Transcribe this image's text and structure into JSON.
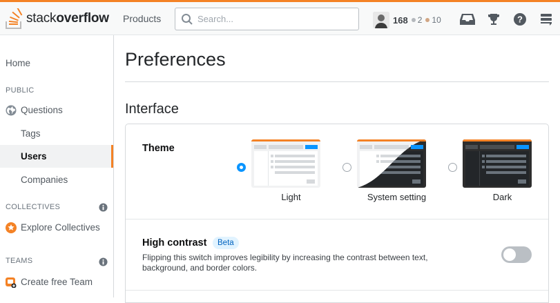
{
  "header": {
    "logo_text_light": "stack",
    "logo_text_bold": "overflow",
    "products_label": "Products",
    "search_placeholder": "Search...",
    "reputation": "168",
    "silver_badges": "2",
    "bronze_badges": "10",
    "accent_color": "#f48225"
  },
  "sidebar": {
    "home": "Home",
    "public_label": "PUBLIC",
    "questions": "Questions",
    "tags": "Tags",
    "users": "Users",
    "companies": "Companies",
    "collectives_label": "COLLECTIVES",
    "explore_collectives": "Explore Collectives",
    "teams_label": "TEAMS",
    "create_team": "Create free Team"
  },
  "main": {
    "title": "Preferences",
    "section": "Interface",
    "theme_label": "Theme",
    "theme_options": [
      {
        "label": "Light",
        "selected": true
      },
      {
        "label": "System setting",
        "selected": false
      },
      {
        "label": "Dark",
        "selected": false
      }
    ],
    "high_contrast_label": "High contrast",
    "beta_badge": "Beta",
    "high_contrast_desc": "Flipping this switch improves legibility by increasing the contrast between text, background, and border colors.",
    "high_contrast_on": false
  }
}
